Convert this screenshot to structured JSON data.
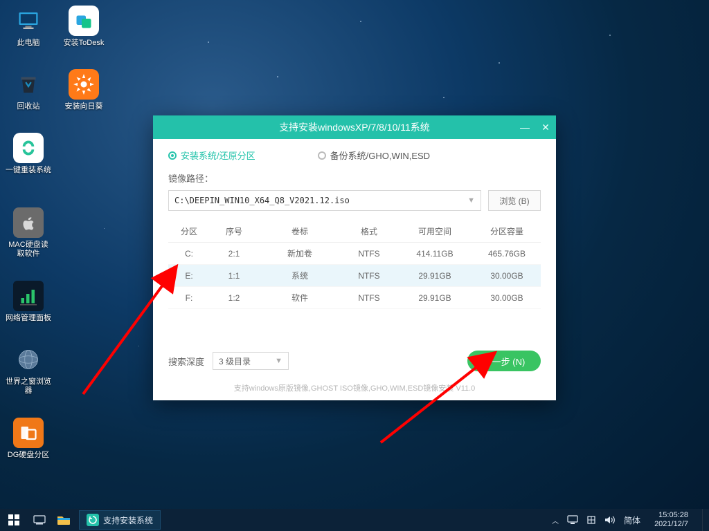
{
  "desktop_icons": [
    {
      "name": "thispc",
      "label": "此电脑"
    },
    {
      "name": "todesk",
      "label": "安装ToDesk"
    },
    {
      "name": "recycle",
      "label": "回收站"
    },
    {
      "name": "sunflower",
      "label": "安装向日葵"
    },
    {
      "name": "reinstall",
      "label": "一键重装系统"
    },
    {
      "name": "macdisk",
      "label": "MAC硬盘读\n取软件"
    },
    {
      "name": "netpanel",
      "label": "网络管理面板"
    },
    {
      "name": "browser",
      "label": "世界之窗浏览\n器"
    },
    {
      "name": "dgdisk",
      "label": "DG硬盘分区"
    }
  ],
  "installer": {
    "title": "支持安装windowsXP/7/8/10/11系统",
    "radio_install": "安装系统/还原分区",
    "radio_backup": "备份系统/GHO,WIN,ESD",
    "image_path_label": "镜像路径：",
    "image_path_value": "C:\\DEEPIN_WIN10_X64_Q8_V2021.12.iso",
    "browse_label": "浏览 (B)",
    "columns": {
      "drive": "分区",
      "index": "序号",
      "volume": "卷标",
      "format": "格式",
      "free": "可用空间",
      "total": "分区容量"
    },
    "rows": [
      {
        "drive": "C:",
        "index": "2:1",
        "volume": "新加卷",
        "format": "NTFS",
        "free": "414.11GB",
        "total": "465.76GB",
        "selected": false
      },
      {
        "drive": "E:",
        "index": "1:1",
        "volume": "系统",
        "format": "NTFS",
        "free": "29.91GB",
        "total": "30.00GB",
        "selected": true
      },
      {
        "drive": "F:",
        "index": "1:2",
        "volume": "软件",
        "format": "NTFS",
        "free": "29.91GB",
        "total": "30.00GB",
        "selected": false
      }
    ],
    "search_depth_label": "搜索深度",
    "search_depth_value": "3 级目录",
    "next_label": "下一步 (N)",
    "footer": "支持windows原版镜像,GHOST ISO镜像,GHO,WIM,ESD镜像安装 V11.0"
  },
  "taskbar": {
    "task_label": "支持安装系统",
    "ime": "简体",
    "time": "15:05:28",
    "date": "2021/12/7"
  },
  "colors": {
    "accent": "#24c1aa",
    "green": "#39c462",
    "red": "#ff0000"
  }
}
